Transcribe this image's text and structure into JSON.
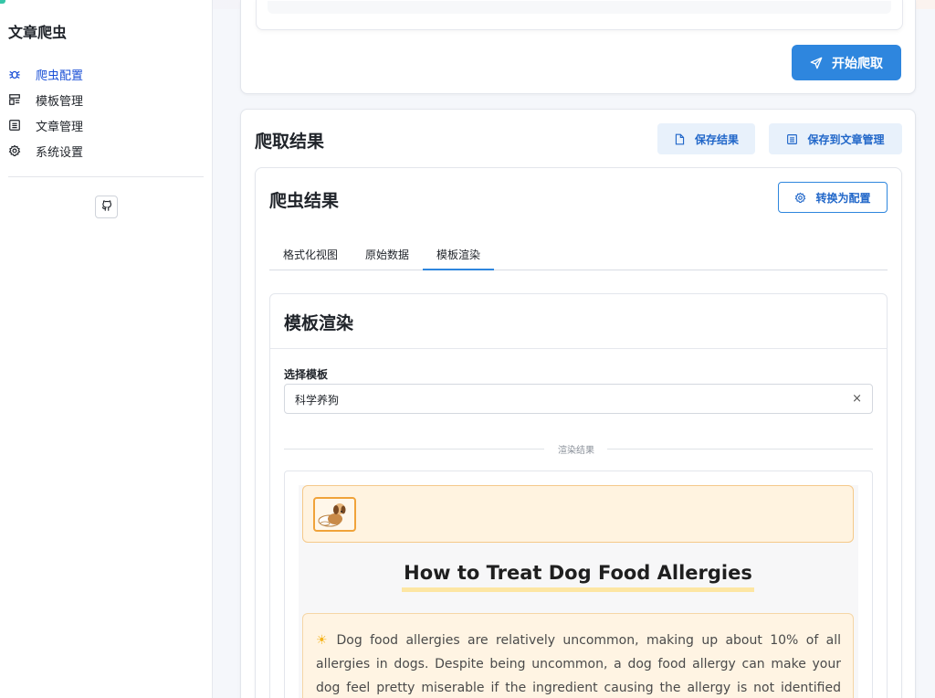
{
  "sidebar": {
    "app_title": "文章爬虫",
    "items": [
      {
        "label": "爬虫配置",
        "icon": "bug-icon",
        "active": true
      },
      {
        "label": "模板管理",
        "icon": "template-icon",
        "active": false
      },
      {
        "label": "文章管理",
        "icon": "document-list-icon",
        "active": false
      },
      {
        "label": "系统设置",
        "icon": "gear-icon",
        "active": false
      }
    ],
    "github_icon": "github-icon"
  },
  "config_card": {
    "start_button": "开始爬取"
  },
  "results": {
    "title": "爬取结果",
    "save_button": "保存结果",
    "save_article_button": "保存到文章管理",
    "crawler": {
      "title": "爬虫结果",
      "convert_button": "转换为配置",
      "tabs": [
        {
          "label": "格式化视图",
          "active": false
        },
        {
          "label": "原始数据",
          "active": false
        },
        {
          "label": "模板渲染",
          "active": true
        }
      ],
      "render": {
        "title": "模板渲染",
        "select_label": "选择模板",
        "selected_template": "科学养狗",
        "clear_symbol": "×",
        "divider_text": "渲染结果",
        "article": {
          "title": "How to Treat Dog Food Allergies",
          "intro": "Dog food allergies are relatively uncommon, making up about 10% of all allergies in dogs. Despite being uncommon, a dog food allergy can make your dog feel pretty miserable if the ingredient causing the allergy is not identified and eliminated from his",
          "intro_icon": "sun-icon",
          "intro_icon_glyph": "☀"
        }
      }
    }
  },
  "colors": {
    "primary": "#2e86de",
    "active_nav": "#1a4fd6",
    "banner_bg": "#fff3e0",
    "title_underline": "#fde6a3"
  }
}
